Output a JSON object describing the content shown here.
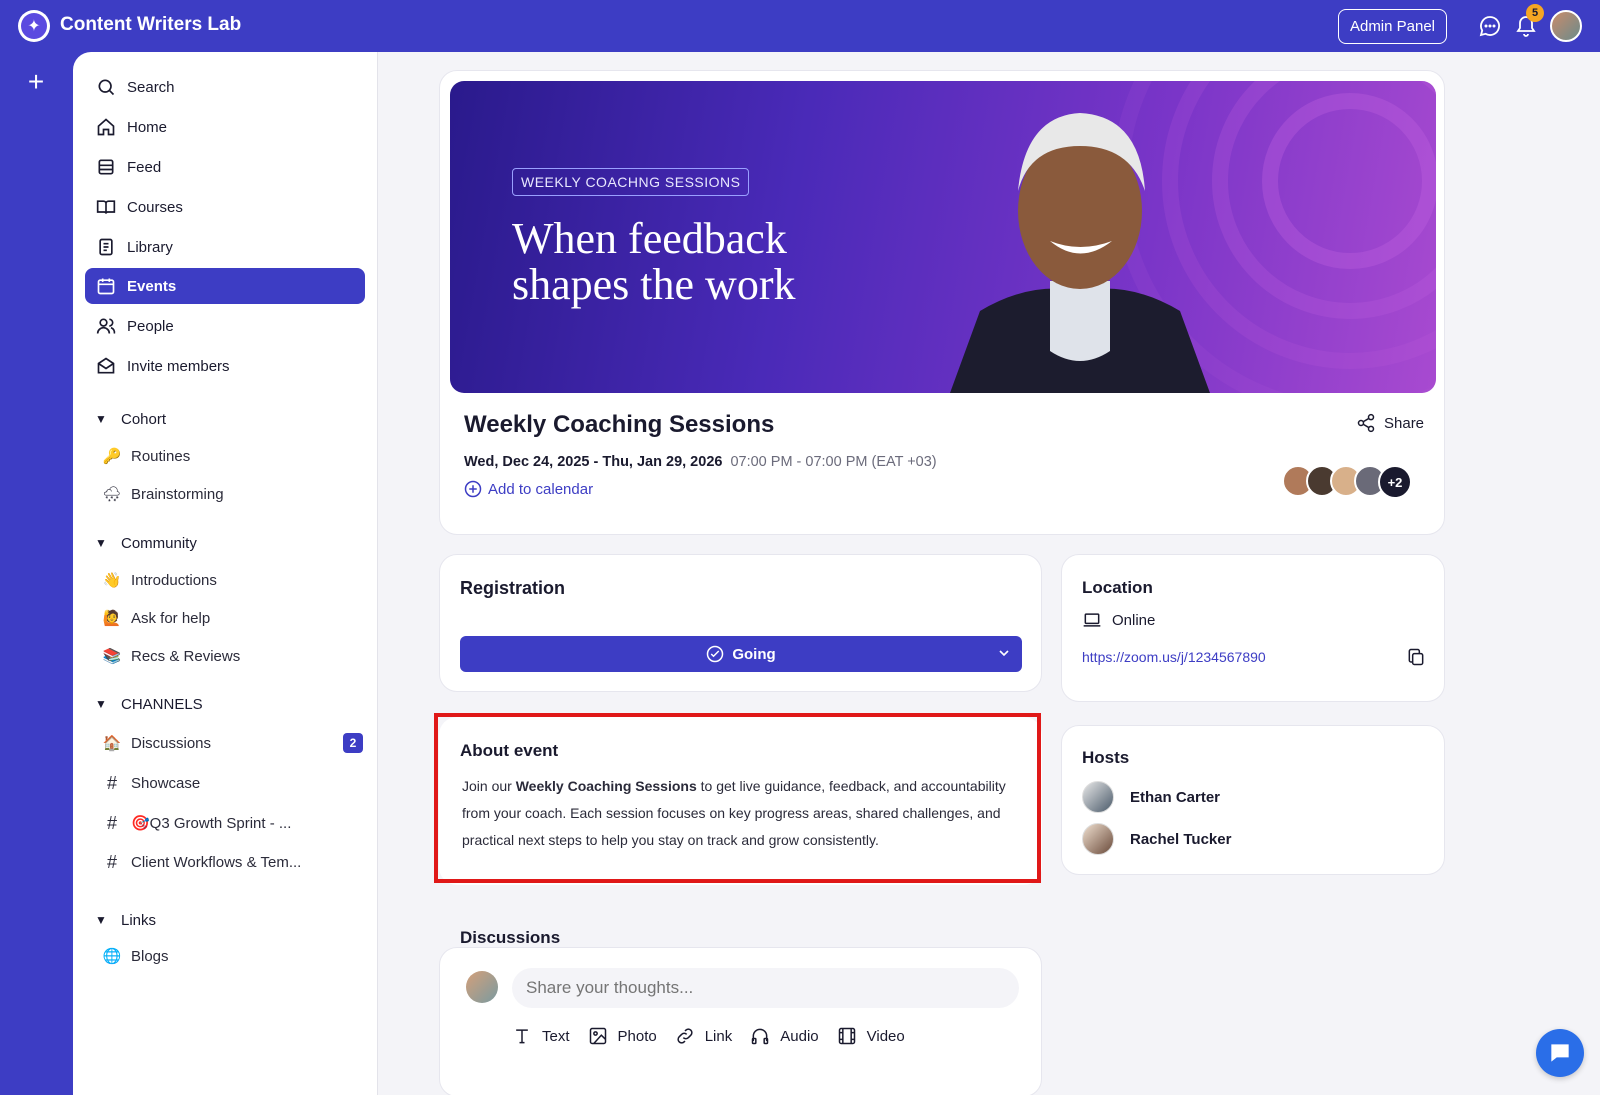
{
  "app": {
    "title": "Content Writers Lab"
  },
  "topbar": {
    "admin_label": "Admin Panel",
    "notification_count": "5"
  },
  "sidebar": {
    "nav": [
      {
        "label": "Search",
        "icon": "search-icon"
      },
      {
        "label": "Home",
        "icon": "home-icon"
      },
      {
        "label": "Feed",
        "icon": "feed-icon"
      },
      {
        "label": "Courses",
        "icon": "book-icon"
      },
      {
        "label": "Library",
        "icon": "library-icon"
      },
      {
        "label": "Events",
        "icon": "calendar-icon",
        "active": true
      },
      {
        "label": "People",
        "icon": "people-icon"
      },
      {
        "label": "Invite members",
        "icon": "mail-icon"
      }
    ],
    "cohort": {
      "label": "Cohort",
      "items": [
        {
          "label": "Routines",
          "emoji": "🔑"
        },
        {
          "label": "Brainstorming",
          "emoji": "🌨️"
        }
      ]
    },
    "community": {
      "label": "Community",
      "items": [
        {
          "label": "Introductions",
          "emoji": "👋"
        },
        {
          "label": "Ask for help",
          "emoji": "🙋"
        },
        {
          "label": "Recs & Reviews",
          "emoji": "📚"
        }
      ]
    },
    "channels": {
      "label": "CHANNELS",
      "items": [
        {
          "label": "Discussions",
          "emoji": "🏠",
          "badge": "2"
        },
        {
          "label": "Showcase",
          "emoji": "#"
        },
        {
          "label": "🎯Q3 Growth Sprint - ...",
          "emoji": "#"
        },
        {
          "label": "Client Workflows & Tem...",
          "emoji": "#"
        }
      ]
    },
    "links": {
      "label": "Links",
      "items": [
        {
          "label": "Blogs",
          "emoji": "🌐"
        }
      ]
    }
  },
  "event": {
    "hero_tag": "WEEKLY COACHNG SESSIONS",
    "hero_title": "When feedback shapes the work",
    "title": "Weekly Coaching Sessions",
    "dates": "Wed, Dec 24, 2025 - Thu, Jan 29, 2026",
    "time": "07:00 PM - 07:00 PM (EAT +03)",
    "add_calendar": "Add to calendar",
    "share": "Share",
    "attendees_more": "+2"
  },
  "registration": {
    "title": "Registration",
    "status": "Going"
  },
  "location": {
    "title": "Location",
    "type": "Online",
    "url": "https://zoom.us/j/1234567890"
  },
  "about": {
    "title": "About event",
    "text_pre": "Join our ",
    "text_bold": "Weekly Coaching Sessions",
    "text_post": " to get live guidance, feedback, and accountability from your coach. Each session focuses on key progress areas, shared challenges, and practical next steps to help you stay on track and grow consistently."
  },
  "hosts": {
    "title": "Hosts",
    "items": [
      "Ethan Carter",
      "Rachel Tucker"
    ]
  },
  "discussions": {
    "title": "Discussions",
    "placeholder": "Share your thoughts...",
    "tools": [
      "Text",
      "Photo",
      "Link",
      "Audio",
      "Video"
    ]
  }
}
